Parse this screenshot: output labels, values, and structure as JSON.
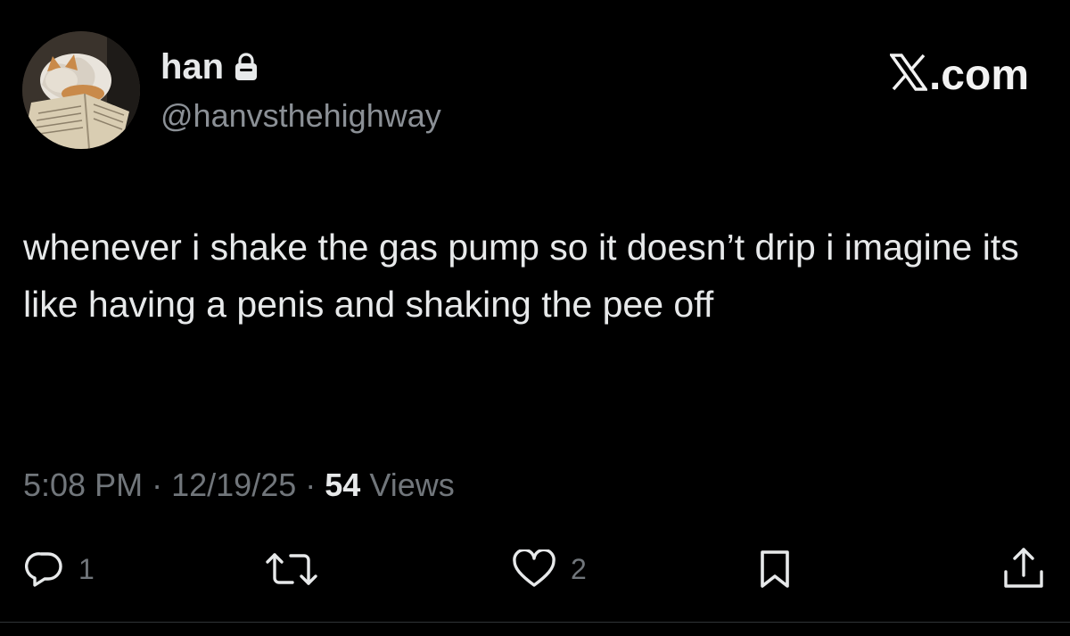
{
  "author": {
    "display_name": "han",
    "handle": "@hanvsthehighway",
    "protected": true,
    "avatar_icon": "cat-reading-book-avatar"
  },
  "brand": {
    "label": ".com",
    "logo_icon": "x-logo-icon"
  },
  "tweet": {
    "text": "whenever i shake the gas pump so it doesn’t drip i imagine its like having a penis and shaking the pee off",
    "time": "5:08 PM",
    "separator": "·",
    "date": "12/19/25",
    "views_count": "54",
    "views_label": "Views"
  },
  "actions": {
    "reply_count": "1",
    "retweet_count": "",
    "like_count": "2"
  },
  "colors": {
    "background": "#000000",
    "primary_text": "#e7e9ea",
    "secondary_text": "#71767b",
    "divider": "#2f3336"
  }
}
